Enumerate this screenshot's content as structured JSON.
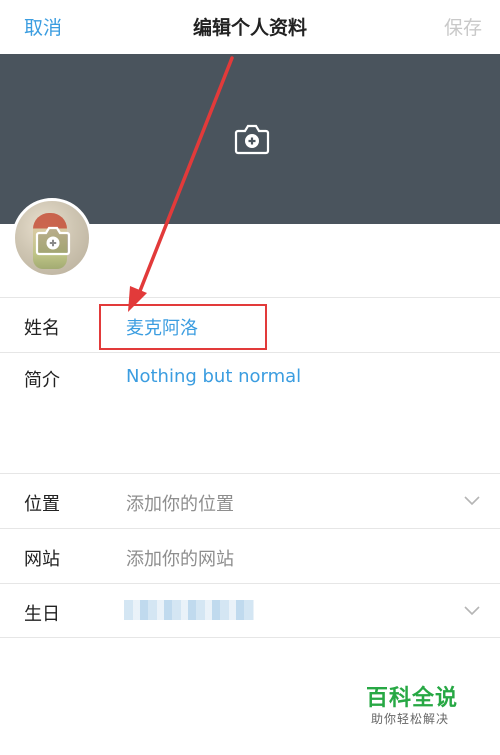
{
  "nav": {
    "cancel_label": "取消",
    "title": "编辑个人资料",
    "save_label": "保存"
  },
  "profile": {
    "name_label": "姓名",
    "name_value": "麦克阿洛",
    "bio_label": "简介",
    "bio_value": "Nothing but normal",
    "location_label": "位置",
    "location_placeholder": "添加你的位置",
    "website_label": "网站",
    "website_placeholder": "添加你的网站",
    "birthday_label": "生日"
  },
  "watermark": {
    "main": "百科全说",
    "sub": "助你轻松解决"
  },
  "colors": {
    "accent": "#3b9de0",
    "banner": "#4a545d",
    "annotation": "#e23a3a",
    "watermark": "#27a844"
  }
}
